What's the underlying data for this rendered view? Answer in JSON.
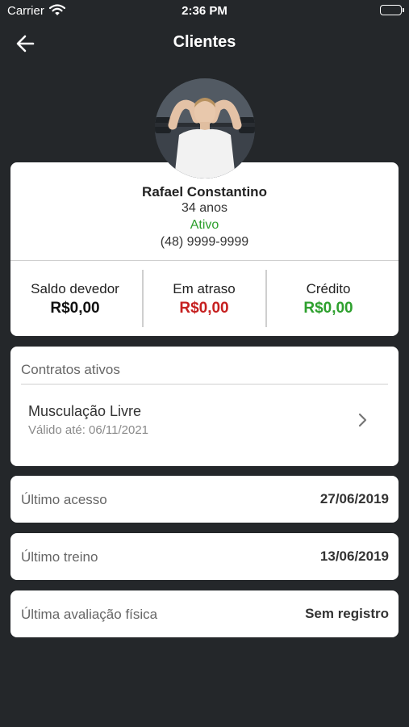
{
  "status_bar": {
    "carrier": "Carrier",
    "time": "2:36 PM"
  },
  "nav": {
    "title": "Clientes"
  },
  "profile": {
    "name": "Rafael Constantino",
    "age": "34 anos",
    "status": "Ativo",
    "phone": "(48) 9999-9999"
  },
  "balances": [
    {
      "label": "Saldo devedor",
      "value": "R$0,00",
      "color": "#111111"
    },
    {
      "label": "Em atraso",
      "value": "R$0,00",
      "color": "#c62020"
    },
    {
      "label": "Crédito",
      "value": "R$0,00",
      "color": "#2ea02e"
    }
  ],
  "contracts": {
    "header": "Contratos ativos",
    "items": [
      {
        "name": "Musculação Livre",
        "valid": "Válido até: 06/11/2021"
      }
    ]
  },
  "info": [
    {
      "label": "Último acesso",
      "value": "27/06/2019"
    },
    {
      "label": "Último treino",
      "value": "13/06/2019"
    },
    {
      "label": "Última avaliação física",
      "value": "Sem registro"
    }
  ],
  "colors": {
    "background": "#24272a",
    "card": "#ffffff",
    "active_green": "#2ea02e",
    "overdue_red": "#c62020"
  },
  "icons": [
    "wifi-icon",
    "battery-icon",
    "back-arrow-icon",
    "chevron-right-icon"
  ]
}
